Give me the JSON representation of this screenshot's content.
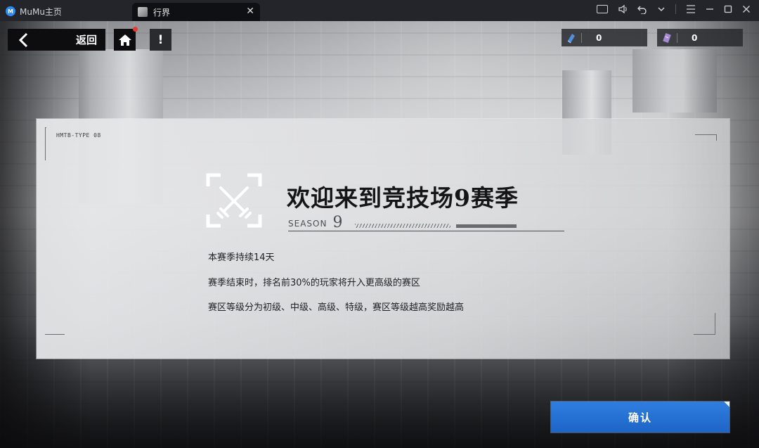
{
  "titlebar": {
    "home_tab_label": "MuMu主页",
    "active_tab_label": "行界",
    "close_glyph": "✕",
    "icons": [
      "keyboard-icon",
      "volume-icon",
      "undo-icon",
      "chevron-down-icon",
      "menu-icon",
      "minimize-icon",
      "maximize-icon",
      "close-icon"
    ]
  },
  "hud": {
    "back_label": "返回",
    "info_label": "!",
    "resources": [
      {
        "icon": "blue-card-icon",
        "value": "0",
        "color": "#4f8fe0"
      },
      {
        "icon": "purple-card-icon",
        "value": "0",
        "color": "#a788d8"
      }
    ]
  },
  "panel": {
    "serial": "HMTB-TYPE 08",
    "title": "欢迎来到竞技场9赛季",
    "season_label": "SEASON",
    "season_number": "9",
    "lines": [
      "本赛季持续14天",
      "赛季结束时，排名前30%的玩家将升入更高级的赛区",
      "赛区等级分为初级、中级、高级、特级，赛区等级越高奖励越高"
    ]
  },
  "confirm_label": "确认",
  "colors": {
    "accent": "#2f7fe0",
    "notification_dot": "#e53a2f"
  }
}
